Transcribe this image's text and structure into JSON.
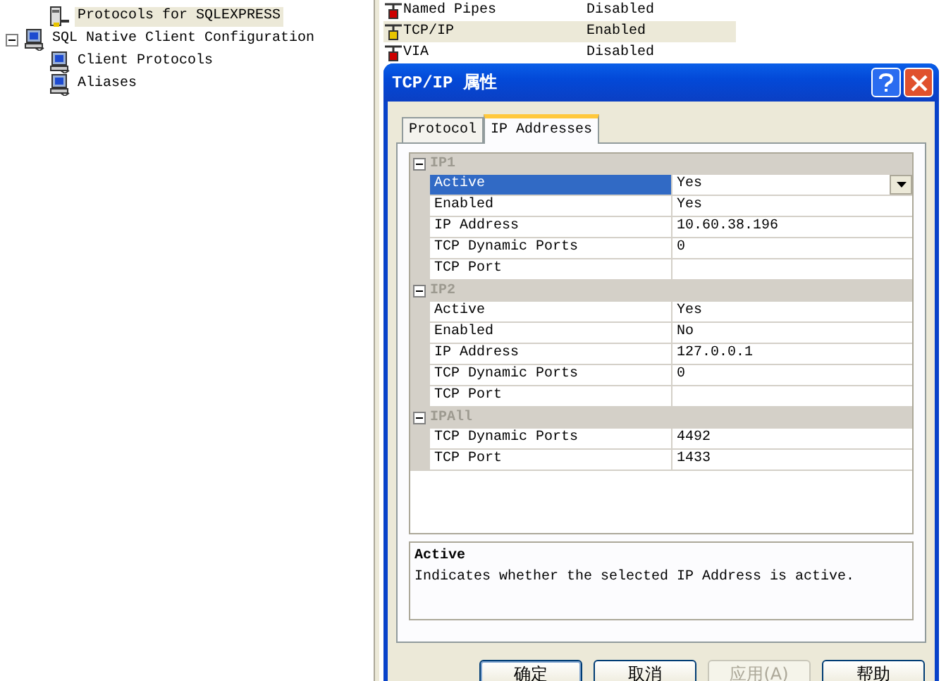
{
  "tree": [
    {
      "children": [
        {
          "label": "Protocols for SQLEXPRESS",
          "selected": true
        }
      ]
    },
    {
      "label": "SQL Native Client Configuration",
      "expanded": true,
      "selected": false,
      "children": [
        {
          "label": "Client Protocols",
          "selected": false
        },
        {
          "label": "Aliases",
          "selected": false
        }
      ]
    }
  ],
  "protocols": [
    {
      "name": "Named Pipes",
      "status": "Disabled",
      "selected": false
    },
    {
      "name": "TCP/IP",
      "status": "Enabled",
      "selected": true
    },
    {
      "name": "VIA",
      "status": "Disabled",
      "selected": false
    }
  ],
  "dialog": {
    "title": "TCP/IP 属性",
    "tabs": [
      {
        "label": "Protocol",
        "selected": false
      },
      {
        "label": "IP Addresses",
        "selected": true
      }
    ],
    "groups": [
      {
        "name": "IP1",
        "expanded": true,
        "properties": [
          {
            "name": "Active",
            "value": "Yes",
            "selected": true
          },
          {
            "name": "Enabled",
            "value": "Yes",
            "selected": false
          },
          {
            "name": "IP Address",
            "value": "10.60.38.196",
            "selected": false
          },
          {
            "name": "TCP Dynamic Ports",
            "value": "0",
            "selected": false
          },
          {
            "name": "TCP Port",
            "selected": false
          }
        ]
      },
      {
        "name": "IP2",
        "expanded": true,
        "properties": [
          {
            "name": "Active",
            "value": "Yes",
            "selected": false
          },
          {
            "name": "Enabled",
            "value": "No",
            "selected": false
          },
          {
            "name": "IP Address",
            "value": "127.0.0.1",
            "selected": false
          },
          {
            "name": "TCP Dynamic Ports",
            "value": "0",
            "selected": false
          },
          {
            "name": "TCP Port",
            "selected": false
          }
        ]
      },
      {
        "name": "IPAll",
        "expanded": true,
        "properties": [
          {
            "name": "TCP Dynamic Ports",
            "value": "4492",
            "selected": false
          },
          {
            "name": "TCP Port",
            "value": "1433",
            "selected": false
          }
        ]
      }
    ],
    "description": {
      "title": "Active",
      "text": "Indicates whether the selected IP Address is active."
    },
    "buttons": [
      {
        "label": "确定",
        "default": true,
        "disabled": false
      },
      {
        "label": "取消",
        "default": false,
        "disabled": false
      },
      {
        "label": "应用(A)",
        "default": false,
        "disabled": true
      },
      {
        "label": "帮助",
        "default": false,
        "disabled": false
      }
    ]
  }
}
